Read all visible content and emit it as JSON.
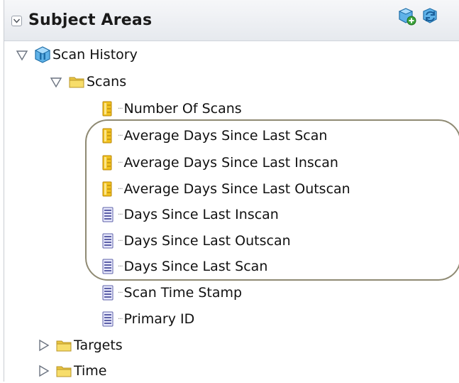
{
  "header": {
    "title": "Subject Areas",
    "icons": [
      "add-subject-area-icon",
      "refresh-icon"
    ]
  },
  "tree": {
    "root": {
      "label": "Scan History",
      "icon": "subject-area-cube-icon",
      "expanded": true
    },
    "folders": [
      {
        "label": "Scans",
        "icon": "folder-icon",
        "expanded": true
      },
      {
        "label": "Targets",
        "icon": "folder-icon",
        "expanded": false
      },
      {
        "label": "Time",
        "icon": "folder-icon",
        "expanded": false
      }
    ],
    "scan_items": [
      {
        "label": "Number Of Scans",
        "type": "measure"
      },
      {
        "label": "Average Days Since Last Scan",
        "type": "measure"
      },
      {
        "label": "Average Days Since Last Inscan",
        "type": "measure"
      },
      {
        "label": "Average Days Since Last Outscan",
        "type": "measure"
      },
      {
        "label": "Days Since Last Inscan",
        "type": "attribute"
      },
      {
        "label": "Days Since Last Outscan",
        "type": "attribute"
      },
      {
        "label": "Days Since Last Scan",
        "type": "attribute"
      },
      {
        "label": "Scan Time Stamp",
        "type": "attribute"
      },
      {
        "label": "Primary ID",
        "type": "attribute"
      }
    ]
  },
  "colors": {
    "folder": "#f3d35a",
    "measure": "#f2c21e",
    "attribute": "#8c8fd8",
    "highlight_border": "#8f8a73"
  }
}
